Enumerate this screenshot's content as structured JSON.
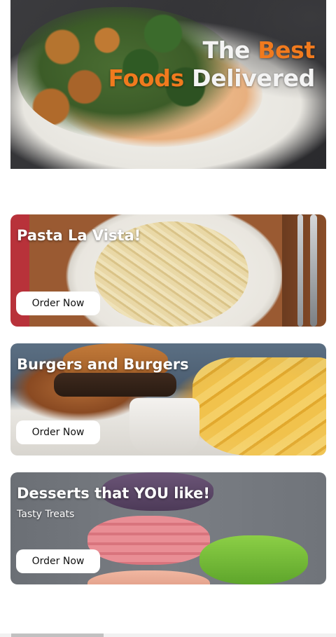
{
  "hero": {
    "title_part1": "The ",
    "title_accent1": "Best",
    "title_accent2": "Foods",
    "title_part2": " Delivered",
    "accent_color": "#f07a1e"
  },
  "cards": [
    {
      "title": "Pasta La Vista!",
      "subtitle": "",
      "button_label": "Order Now"
    },
    {
      "title": "Burgers and Burgers",
      "subtitle": "",
      "button_label": "Order Now"
    },
    {
      "title": "Desserts that YOU like!",
      "subtitle": "Tasty Treats",
      "button_label": "Order Now"
    }
  ]
}
